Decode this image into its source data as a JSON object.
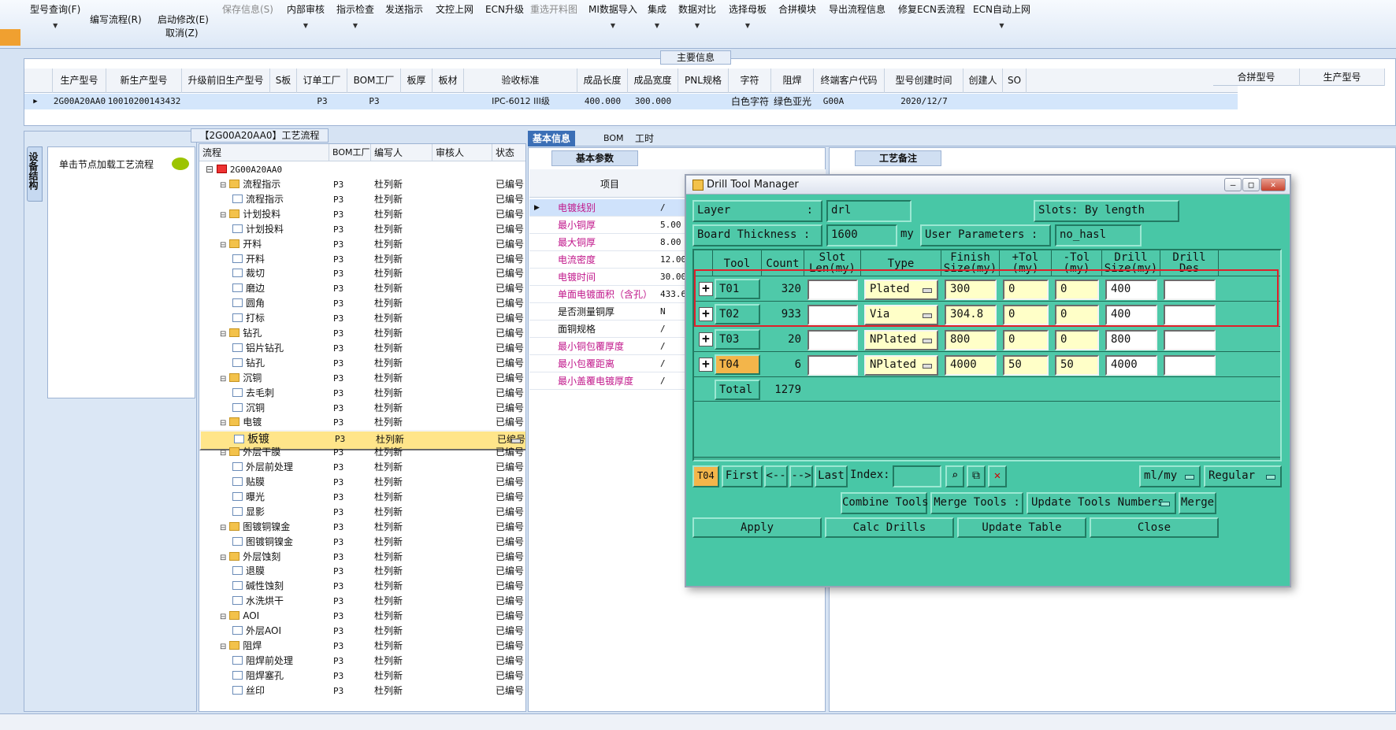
{
  "toolbar": {
    "items": [
      "型号查询(F)",
      "编写流程(R)",
      "启动修改(E)",
      "取消(Z)",
      "保存信息(S)",
      "内部审核",
      "指示检查",
      "发送指示",
      "文控上网",
      "ECN升级",
      "重选开料图",
      "MI数据导入",
      "集成",
      "数据对比",
      "选择母板",
      "合拼模块",
      "导出流程信息",
      "修复ECN丢流程",
      "ECN自动上网"
    ]
  },
  "main_info": {
    "title": "主要信息",
    "columns": [
      "生产型号",
      "新生产型号",
      "升级前旧生产型号",
      "S板",
      "订单工厂",
      "BOM工厂",
      "板厚",
      "板材",
      "验收标准",
      "成品长度",
      "成品宽度",
      "PNL规格",
      "字符",
      "阻焊",
      "终端客户代码",
      "型号创建时间",
      "创建人",
      "SO"
    ],
    "row": [
      "2G00A20AA0",
      "10010200143432",
      "",
      "",
      "P3",
      "P3",
      "",
      "",
      "IPC-6012 III级",
      "400.000",
      "300.000",
      "",
      "白色字符",
      "绿色亚光",
      "G00A",
      "2020/12/7",
      "",
      ""
    ],
    "right_columns": [
      "合拼型号",
      "生产型号"
    ]
  },
  "side_tab": "设备结构",
  "flow": {
    "title": "【2G00A20AA0】工艺流程",
    "hint": "单击节点加载工艺流程",
    "columns": [
      "流程",
      "BOM工厂",
      "编写人",
      "审核人",
      "状态"
    ],
    "root": "2G00A20AA0",
    "rows": [
      {
        "n": "流程指示",
        "lvl": 1
      },
      {
        "n": "流程指示",
        "lvl": 2
      },
      {
        "n": "计划投料",
        "lvl": 1
      },
      {
        "n": "计划投料",
        "lvl": 2
      },
      {
        "n": "开料",
        "lvl": 1
      },
      {
        "n": "开料",
        "lvl": 2
      },
      {
        "n": "裁切",
        "lvl": 2
      },
      {
        "n": "磨边",
        "lvl": 2
      },
      {
        "n": "圆角",
        "lvl": 2
      },
      {
        "n": "打标",
        "lvl": 2
      },
      {
        "n": "钻孔",
        "lvl": 1
      },
      {
        "n": "铝片钻孔",
        "lvl": 2
      },
      {
        "n": "钻孔",
        "lvl": 2
      },
      {
        "n": "沉铜",
        "lvl": 1
      },
      {
        "n": "去毛刺",
        "lvl": 2
      },
      {
        "n": "沉铜",
        "lvl": 2
      },
      {
        "n": "电镀",
        "lvl": 1
      },
      {
        "n": "板镀",
        "lvl": 2,
        "sel": true
      },
      {
        "n": "外层干膜",
        "lvl": 1
      },
      {
        "n": "外层前处理",
        "lvl": 2
      },
      {
        "n": "贴膜",
        "lvl": 2
      },
      {
        "n": "曝光",
        "lvl": 2
      },
      {
        "n": "显影",
        "lvl": 2
      },
      {
        "n": "图镀铜镍金",
        "lvl": 1
      },
      {
        "n": "图镀铜镍金",
        "lvl": 2
      },
      {
        "n": "外层蚀刻",
        "lvl": 1
      },
      {
        "n": "退膜",
        "lvl": 2
      },
      {
        "n": "碱性蚀刻",
        "lvl": 2
      },
      {
        "n": "水洗烘干",
        "lvl": 2
      },
      {
        "n": "AOI",
        "lvl": 1
      },
      {
        "n": "外层AOI",
        "lvl": 2
      },
      {
        "n": "阻焊",
        "lvl": 1
      },
      {
        "n": "阻焊前处理",
        "lvl": 2
      },
      {
        "n": "阻焊塞孔",
        "lvl": 2
      },
      {
        "n": "丝印",
        "lvl": 2
      }
    ],
    "bom": "P3",
    "author": "杜列新",
    "status": "已编号"
  },
  "basic": {
    "tabs": [
      "基本信息",
      "BOM",
      "工时"
    ],
    "panel_title": "基本参数",
    "col_item": "项目",
    "rows": [
      {
        "k": "电镀线别",
        "v": "/",
        "red": true
      },
      {
        "k": "最小铜厚",
        "v": "5.00",
        "red": true
      },
      {
        "k": "最大铜厚",
        "v": "8.00",
        "red": true
      },
      {
        "k": "电流密度",
        "v": "12.00",
        "red": true
      },
      {
        "k": "电镀时间",
        "v": "30.00",
        "red": true
      },
      {
        "k": "单面电镀面积（含孔）",
        "v": "433.6",
        "red": true
      },
      {
        "k": "是否测量铜厚",
        "v": "N",
        "red": false
      },
      {
        "k": "面铜规格",
        "v": "/",
        "red": false
      },
      {
        "k": "最小铜包覆厚度",
        "v": "/",
        "red": true
      },
      {
        "k": "最小包覆距离",
        "v": "/",
        "red": true
      },
      {
        "k": "最小盖覆电镀厚度",
        "v": "/",
        "red": true
      }
    ],
    "memo_title": "工艺备注"
  },
  "dtm": {
    "title": "Drill Tool Manager",
    "layer_label": "Layer",
    "layer_sep": ":",
    "layer_value": "drl",
    "slots_label": "Slots:",
    "slots_value": "By length",
    "thickness_label": "Board Thickness :",
    "thickness_value": "1600",
    "thickness_unit": "my",
    "user_params_label": "User Parameters :",
    "user_params_value": "no_hasl",
    "columns": [
      "Tool",
      "Count",
      "Slot Len(my)",
      "Type",
      "Finish Size(my)",
      "+Tol (my)",
      "-Tol (my)",
      "Drill Size(my)",
      "Drill Des"
    ],
    "tools": [
      {
        "tool": "T01",
        "count": "320",
        "type": "Plated",
        "finish": "300",
        "ptol": "0",
        "mtol": "0",
        "drill": "400"
      },
      {
        "tool": "T02",
        "count": "933",
        "type": "Via",
        "finish": "304.8",
        "ptol": "0",
        "mtol": "0",
        "drill": "400"
      },
      {
        "tool": "T03",
        "count": "20",
        "type": "NPlated",
        "finish": "800",
        "ptol": "0",
        "mtol": "0",
        "drill": "800"
      },
      {
        "tool": "T04",
        "count": "6",
        "type": "NPlated",
        "finish": "4000",
        "ptol": "50",
        "mtol": "50",
        "drill": "4000"
      }
    ],
    "total_label": "Total",
    "total_count": "1279",
    "current_tool": "T04",
    "nav": {
      "first": "First",
      "prev": "<--",
      "next": "-->",
      "last": "Last",
      "index": "Index:"
    },
    "units": "ml/my",
    "mode": "Regular",
    "combine": "Combine Tools",
    "merge_label": "Merge Tools :",
    "merge_value": "Update Tools Numbers",
    "merge_btn": "Merge",
    "apply": "Apply",
    "calc": "Calc Drills",
    "update": "Update Table",
    "close": "Close"
  }
}
